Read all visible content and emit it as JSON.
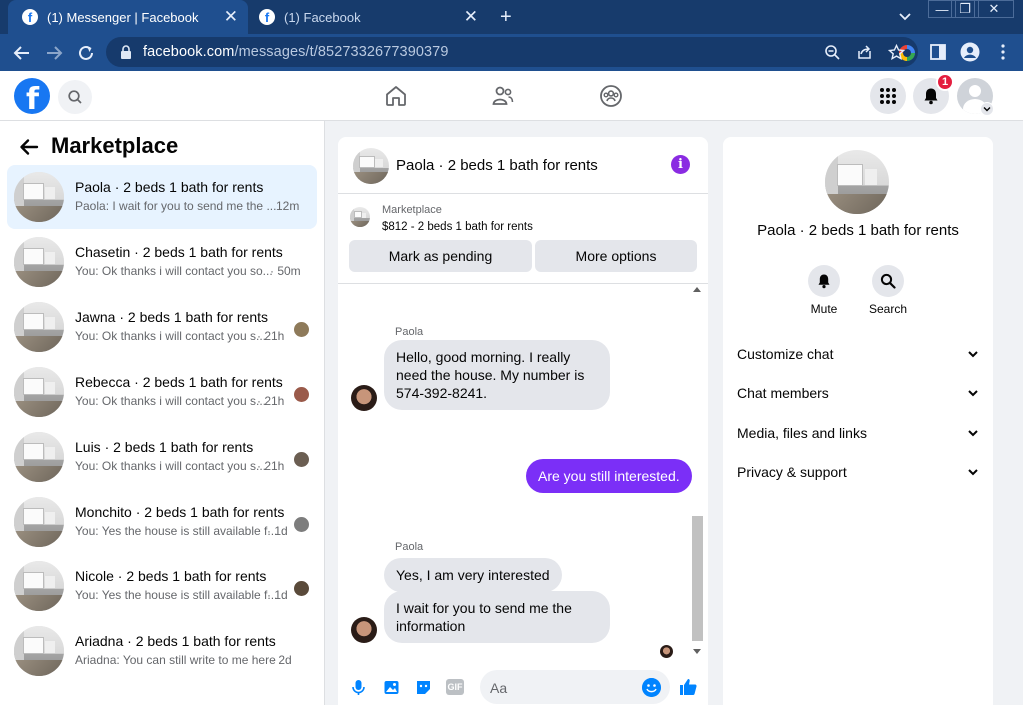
{
  "browser": {
    "tabs": [
      {
        "label": "(1) Messenger | Facebook",
        "favicon": "f"
      },
      {
        "label": "(1) Facebook",
        "favicon": "f"
      }
    ],
    "new_tab": "+",
    "url_host": "facebook.com",
    "url_path": "/messages/t/8527332677390379"
  },
  "header": {
    "logo": "f",
    "notification_count": "1"
  },
  "left": {
    "title": "Marketplace",
    "conversations": [
      {
        "name": "Paola · 2 beds 1 bath for rents",
        "preview": "Paola: I wait for you to send me the ...",
        "time": "12m",
        "selected": true
      },
      {
        "name": "Chasetin · 2 beds 1 bath for rents",
        "preview": "You: Ok thanks i will contact you so...",
        "time": "· 50m"
      },
      {
        "name": "Jawna · 2 beds 1 bath for rents",
        "preview": "You: Ok thanks i will contact you s...",
        "time": "· 21h"
      },
      {
        "name": "Rebecca · 2 beds 1 bath for rents",
        "preview": "You: Ok thanks i will contact you s...",
        "time": "· 21h"
      },
      {
        "name": "Luis · 2 beds 1 bath for rents",
        "preview": "You: Ok thanks i will contact you s...",
        "time": "· 21h"
      },
      {
        "name": "Monchito · 2 beds 1 bath for rents",
        "preview": "You: Yes the house is still available f...",
        "time": "· 1d"
      },
      {
        "name": "Nicole · 2 beds 1 bath for rents",
        "preview": "You: Yes the house is still available f...",
        "time": "· 1d"
      },
      {
        "name": "Ariadna · 2 beds 1 bath for rents",
        "preview": "Ariadna: You can still write to me here",
        "time": "· 2d"
      }
    ]
  },
  "chat": {
    "title": "Paola · 2 beds 1 bath for rents",
    "info_icon": "i",
    "listing_source": "Marketplace",
    "listing_price": "$812 - 2 beds 1 bath for rents",
    "mark_pending_label": "Mark as pending",
    "more_options_label": "More options",
    "messages": [
      {
        "sender": "Paola",
        "text": "Hello, good morning. I really need the house. My number is 574-392-8241."
      },
      {
        "sender": "me",
        "text": "Are you still interested."
      },
      {
        "sender": "Paola",
        "text": "Yes, I am very interested"
      },
      {
        "sender": "",
        "text": "I wait for you to send me the information"
      }
    ],
    "composer_placeholder": "Aa",
    "gif_label": "GIF"
  },
  "details": {
    "name": "Paola · 2 beds 1 bath for rents",
    "mute_label": "Mute",
    "search_label": "Search",
    "sections": [
      "Customize chat",
      "Chat members",
      "Media, files and links",
      "Privacy & support"
    ]
  }
}
